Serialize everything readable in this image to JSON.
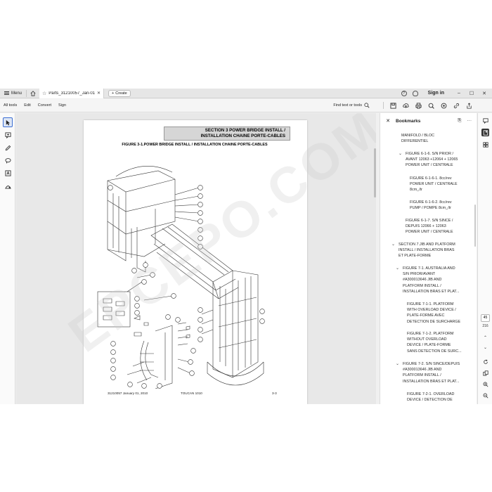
{
  "tabbar": {
    "menu_label": "Menu",
    "tab_title": "Parts_31210057_Jan-01-2...",
    "create_label": "Create",
    "signin_label": "Sign in"
  },
  "toolbar": {
    "menu": [
      "All tools",
      "Edit",
      "Convert",
      "Sign"
    ],
    "find_label": "Find text or tools"
  },
  "document": {
    "section_line1": "SECTION 3   POWER BRIDGE INSTALL /",
    "section_line2": "INSTALLATION CHAINE PORTE-CABLES",
    "figure_title": "FIGURE 3-1.POWER BRIDGE INSTALL / INSTALLATION CHAINE PORTE-CABLES",
    "footer_left": "31210057 January 01, 2010",
    "footer_center": "TOUCAN 1010",
    "footer_right": "3-3",
    "watermark": "EPCEPO.COM"
  },
  "bookmarks": {
    "title": "Bookmarks",
    "items": [
      {
        "text": "MANIFOLD / BLOC\nDIFFERENTIEL",
        "chevron": ""
      },
      {
        "text": "FIGURE 6-1-6. S/N PRIOR /\nAVANT 12063 +12064 + 12065\nPOWER UNIT / CENTRALE",
        "chevron": "⌄"
      },
      {
        "text": "FIGURE 6-1-6-1. 8cc/rev\nPOWER UNIT / CENTRALE\n8cm_/tr",
        "chevron": ""
      },
      {
        "text": "FIGURE 6-1-6-2. 8cc/rev\nPUMP / POMPE 8cm_/tr",
        "chevron": ""
      },
      {
        "text": "FIGURE 6-1-7. S/N SINCE /\nDEPUIS 12066 + 12063\nPOWER UNIT / CENTRALE",
        "chevron": ""
      },
      {
        "text": "SECTION 7.JIB AND PLATFORM\nINSTALL / INSTALLATION BRAS\nET PLATE-FORME",
        "chevron": "⌄"
      },
      {
        "text": "FIGURE 7-1. AUSTRALIA AND\nS/N PRIOR/AVANT\n#A300013646 JIB AND\nPLATFORM INSTALL /\nINSTALLATION BRAS ET PLAT...",
        "chevron": "⌄"
      },
      {
        "text": "FIGURE 7-1-1. PLATFORM\nWITH OVERLOAD DEVICE /\nPLATE-FORME AVEC\nDETECTION DE SURCHARGE",
        "chevron": ""
      },
      {
        "text": "FIGURE 7-1-2. PLATFORM\nWITHOUT OVERLOAD\nDEVICE / PLATE-FORME\nSANS DETECTION DE SURC...",
        "chevron": ""
      },
      {
        "text": "FIGURE 7-2. S/N SINCE/DEPUIS\n#A300013646 JIB AND\nPLATFORM INSTALL /\nINSTALLATION BRAS ET PLAT...",
        "chevron": "⌄"
      },
      {
        "text": "FIGURE 7-2-1. OVERLOAD\nDEVICE / DETECTION DE",
        "chevron": ""
      }
    ]
  },
  "pager": {
    "current": "45",
    "total": "216"
  },
  "colors": {
    "accent": "#3d6fd3",
    "panel_bg": "#ffffff",
    "doc_bg": "#e8e8e8"
  }
}
